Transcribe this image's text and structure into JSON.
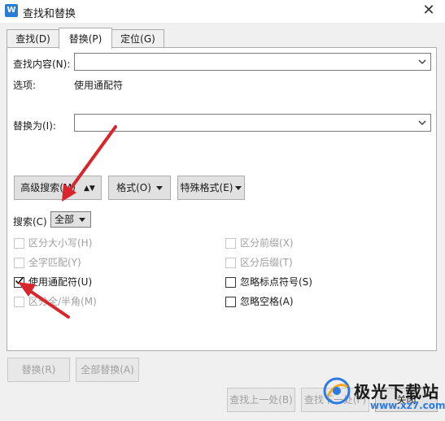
{
  "window": {
    "title": "查找和替换",
    "close_symbol": "✕",
    "app_icon_letter": "W",
    "app_icon_color": "#2b7cd3"
  },
  "tabs": [
    {
      "label": "查找(D)",
      "active": false
    },
    {
      "label": "替换(P)",
      "active": true
    },
    {
      "label": "定位(G)",
      "active": false
    }
  ],
  "find": {
    "label": "查找内容(N):",
    "value": "",
    "options_label": "选项:",
    "options_value": "使用通配符"
  },
  "replace": {
    "label": "替换为(I):",
    "value": ""
  },
  "buttons": {
    "advanced_search": "高级搜索(M)",
    "format": "格式(O)",
    "special_format": "特殊格式(E)"
  },
  "search": {
    "label": "搜索(C)",
    "selected": "全部"
  },
  "checkboxes_left": [
    {
      "label": "区分大小写(H)",
      "checked": false,
      "enabled": false
    },
    {
      "label": "全字匹配(Y)",
      "checked": false,
      "enabled": false
    },
    {
      "label": "使用通配符(U)",
      "checked": true,
      "enabled": true
    },
    {
      "label": "区分全/半角(M)",
      "checked": false,
      "enabled": false
    }
  ],
  "checkboxes_right": [
    {
      "label": "区分前缀(X)",
      "checked": false,
      "enabled": false
    },
    {
      "label": "区分后缀(T)",
      "checked": false,
      "enabled": false
    },
    {
      "label": "忽略标点符号(S)",
      "checked": false,
      "enabled": true
    },
    {
      "label": "忽略空格(A)",
      "checked": false,
      "enabled": true
    }
  ],
  "bottom_buttons": {
    "replace": "替换(R)",
    "replace_all": "全部替换(A)",
    "find_prev": "查找上一处(B)",
    "find_next": "查找下一处(F)",
    "close": "关闭"
  },
  "watermark": {
    "brand": "极光下载站",
    "url": "www.xz7.com"
  },
  "colors": {
    "annotation_arrow": "#d9262c",
    "accent": "#2b7cd3"
  }
}
